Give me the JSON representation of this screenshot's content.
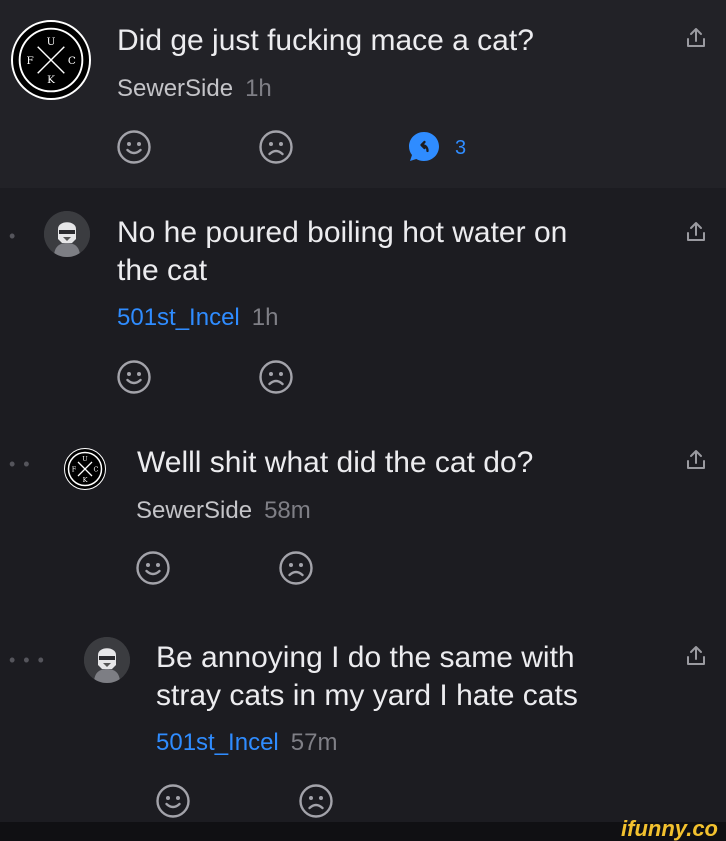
{
  "comments": [
    {
      "text": "Did ge just fucking mace a cat?",
      "username": "SewerSide",
      "time": "1h",
      "replies": "3",
      "avatar_letters": {
        "top": "U",
        "left": "F",
        "right": "C",
        "bottom": "K"
      }
    },
    {
      "text_line1": "No he poured boiling hot water on",
      "text_line2": "the cat",
      "username": "501st_Incel",
      "time": "1h"
    },
    {
      "text": "Welll shit what did the cat do?",
      "username": "SewerSide",
      "time": "58m",
      "avatar_letters": {
        "top": "U",
        "left": "F",
        "right": "C",
        "bottom": "K"
      }
    },
    {
      "text_line1": "Be annoying I do the same with",
      "text_line2": "stray cats in my yard I hate cats",
      "username": "501st_Incel",
      "time": "57m"
    }
  ],
  "icons": {
    "share": "share-up-arrow-icon",
    "smile": "smiley-face-icon",
    "frown": "frown-face-icon",
    "reply": "reply-bubble-icon"
  },
  "colors": {
    "background": "#1c1c21",
    "top_comment_background": "#222227",
    "accent_blue": "#2f8cff",
    "watermark": "#f2c12e"
  },
  "watermark": "ifunny.co"
}
